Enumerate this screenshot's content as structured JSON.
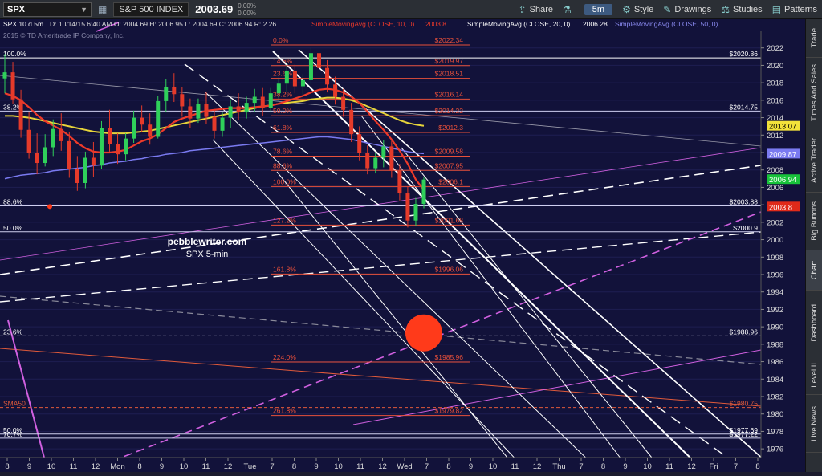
{
  "toolbar": {
    "symbol": "SPX",
    "index_name": "S&P 500 INDEX",
    "last_price": "2003.69",
    "change": "0.00%",
    "change2": "0.00%",
    "share": "Share",
    "timeframe": "5m",
    "style": "Style",
    "drawings": "Drawings",
    "studies": "Studies",
    "patterns": "Patterns"
  },
  "header": {
    "info": "SPX 10 d 5m",
    "ohlc": "D: 10/14/15 6:40 AM   O: 2004.69   H: 2006.95   L: 2004.69   C: 2006.94   R: 2.26",
    "sma10": "SimpleMovingAvg (CLOSE, 10, 0)",
    "sma10_val": "2003.8",
    "sma20": "SimpleMovingAvg (CLOSE, 20, 0)",
    "sma20_val": "2006.28",
    "sma50": "SimpleMovingAvg (CLOSE, 50, 0)",
    "copyright": "2015 © TD Ameritrade IP Company, Inc."
  },
  "watermark": {
    "line1": "pebblewriter.com",
    "line2": "SPX 5-min"
  },
  "sidebar": [
    "Trade",
    "Times And Sales",
    "Active Trader",
    "Big Buttons",
    "Chart",
    "Dashboard",
    "Level II",
    "Live News"
  ],
  "sidebar_active": "Chart",
  "colors": {
    "bg": "#12123a",
    "sma10": "#ee3a2a",
    "sma20": "#e6d43a",
    "sma50": "#7a7af0",
    "up": "#2fd05a",
    "down": "#e53a2a",
    "fib": "#e8503a",
    "channel": "#ffffff",
    "magenta": "#d060e0",
    "target": "#ff3a1a"
  },
  "chart_data": {
    "type": "candlestick",
    "y_axis": {
      "min": 1975,
      "max": 2024,
      "ticks": [
        1976,
        1978,
        1980,
        1982,
        1984,
        1986,
        1988,
        1990,
        1992,
        1994,
        1996,
        1998,
        2000,
        2002,
        2004,
        2006,
        2008,
        2010,
        2012,
        2014,
        2016,
        2018,
        2020,
        2022
      ]
    },
    "x_ticks": [
      "8",
      "9",
      "10",
      "11",
      "12",
      "Mon",
      "8",
      "9",
      "10",
      "11",
      "12",
      "Tue",
      "7",
      "8",
      "9",
      "10",
      "11",
      "12",
      "Wed",
      "7",
      "8",
      "9",
      "10",
      "11",
      "12",
      "Thu",
      "7",
      "8",
      "9",
      "10",
      "11",
      "12",
      "Fri",
      "7",
      "8"
    ],
    "price_tags": [
      {
        "label": "2013.07",
        "value": 2013.07,
        "color": "#f2e23a",
        "text": "#000"
      },
      {
        "label": "2009.87",
        "value": 2009.87,
        "color": "#7a7af0",
        "text": "#fff"
      },
      {
        "label": "2006.94",
        "value": 2006.94,
        "color": "#18c23a",
        "text": "#fff"
      },
      {
        "label": "2003.8",
        "value": 2003.8,
        "color": "#e02a1a",
        "text": "#fff"
      }
    ],
    "fib_right": [
      {
        "pct": "0.0%",
        "label": "$2022.34",
        "value": 2022.34
      },
      {
        "pct": "14.6%",
        "label": "$2019.97",
        "value": 2019.97
      },
      {
        "pct": "23.6%",
        "label": "$2018.51",
        "value": 2018.51
      },
      {
        "pct": "38.2%",
        "label": "$2016.14",
        "value": 2016.14
      },
      {
        "pct": "50.0%",
        "label": "$2014.22",
        "value": 2014.22
      },
      {
        "pct": "61.8%",
        "label": "$2012.3",
        "value": 2012.3
      },
      {
        "pct": "78.6%",
        "label": "$2009.58",
        "value": 2009.58
      },
      {
        "pct": "88.6%",
        "label": "$2007.95",
        "value": 2007.95
      },
      {
        "pct": "100.0%",
        "label": "$2006.1",
        "value": 2006.1
      },
      {
        "pct": "127.2%",
        "label": "$2001.68",
        "value": 2001.68
      },
      {
        "pct": "161.8%",
        "label": "$1996.06",
        "value": 1996.06
      },
      {
        "pct": "224.0%",
        "label": "$1985.96",
        "value": 1985.96
      },
      {
        "pct": "261.8%",
        "label": "$1979.82",
        "value": 1979.82
      }
    ],
    "fib_big": [
      {
        "pct": "100.0%",
        "label": "$2020.86",
        "value": 2020.86
      },
      {
        "pct": "38.2%",
        "label": "$2014.75",
        "value": 2014.75
      },
      {
        "pct": "88.6%",
        "label": "$2003.88",
        "value": 2003.88
      },
      {
        "pct": "50.0%",
        "label": "$2000.9",
        "value": 2000.9
      },
      {
        "pct": "23.6%",
        "label": "$1988.96",
        "value": 1988.96
      },
      {
        "pct": "SMA50",
        "label": "$1980.75",
        "value": 1980.75
      },
      {
        "pct": "50.0%",
        "label": "$1977.69",
        "value": 1977.69
      },
      {
        "pct": "70.7%",
        "label": "$1977.22",
        "value": 1977.22
      }
    ],
    "target_circle": {
      "value": 1989.3
    },
    "ohlc": [
      [
        2018.5,
        2021.3,
        2016.8,
        2019.2
      ],
      [
        2019.2,
        2020.4,
        2015.6,
        2016.1
      ],
      [
        2016.1,
        2017.2,
        2011.7,
        2012.6
      ],
      [
        2012.6,
        2014.7,
        2009.3,
        2010.0
      ],
      [
        2010.0,
        2012.2,
        2007.5,
        2008.8
      ],
      [
        2008.8,
        2012.1,
        2008.4,
        2010.6
      ],
      [
        2010.6,
        2013.8,
        2009.6,
        2012.7
      ],
      [
        2012.7,
        2014.5,
        2010.2,
        2011.3
      ],
      [
        2011.3,
        2012.4,
        2007.1,
        2008.1
      ],
      [
        2008.1,
        2009.6,
        2005.6,
        2006.5
      ],
      [
        2006.5,
        2010.1,
        2005.9,
        2009.4
      ],
      [
        2009.4,
        2011.2,
        2007.2,
        2008.5
      ],
      [
        2008.5,
        2013.6,
        2008.1,
        2012.8
      ],
      [
        2012.8,
        2014.9,
        2010.1,
        2011.0
      ],
      [
        2011.0,
        2012.2,
        2008.7,
        2009.8
      ],
      [
        2009.8,
        2012.2,
        2009.1,
        2011.6
      ],
      [
        2011.6,
        2014.8,
        2011.1,
        2014.0
      ],
      [
        2014.0,
        2015.4,
        2012.3,
        2013.2
      ],
      [
        2013.2,
        2014.5,
        2010.9,
        2011.8
      ],
      [
        2011.8,
        2016.5,
        2011.6,
        2015.9
      ],
      [
        2015.9,
        2018.4,
        2014.6,
        2017.5
      ],
      [
        2017.5,
        2019.1,
        2015.8,
        2016.7
      ],
      [
        2016.7,
        2017.5,
        2014.1,
        2015.3
      ],
      [
        2015.3,
        2016.2,
        2012.8,
        2013.9
      ],
      [
        2013.9,
        2016.2,
        2013.4,
        2015.6
      ],
      [
        2015.6,
        2017.0,
        2013.3,
        2014.1
      ],
      [
        2014.1,
        2015.0,
        2011.6,
        2012.5
      ],
      [
        2012.5,
        2014.6,
        2011.8,
        2014.0
      ],
      [
        2014.0,
        2016.1,
        2012.8,
        2015.3
      ],
      [
        2015.3,
        2016.8,
        2013.7,
        2014.6
      ],
      [
        2014.6,
        2016.4,
        2013.9,
        2015.7
      ],
      [
        2015.7,
        2017.3,
        2014.6,
        2016.4
      ],
      [
        2016.4,
        2017.4,
        2014.2,
        2015.1
      ],
      [
        2015.1,
        2017.4,
        2014.6,
        2016.8
      ],
      [
        2016.8,
        2018.6,
        2015.9,
        2017.9
      ],
      [
        2017.9,
        2020.3,
        2016.9,
        2019.4
      ],
      [
        2019.4,
        2020.1,
        2016.8,
        2017.6
      ],
      [
        2017.6,
        2019.0,
        2016.6,
        2018.3
      ],
      [
        2018.3,
        2022.0,
        2017.8,
        2021.4
      ],
      [
        2021.4,
        2022.3,
        2018.8,
        2019.7
      ],
      [
        2019.7,
        2020.6,
        2016.9,
        2017.8
      ],
      [
        2017.8,
        2018.7,
        2015.5,
        2016.4
      ],
      [
        2016.4,
        2017.3,
        2014.1,
        2014.9
      ],
      [
        2014.9,
        2015.7,
        2011.2,
        2012.1
      ],
      [
        2012.1,
        2013.0,
        2009.1,
        2010.0
      ],
      [
        2010.0,
        2010.8,
        2007.5,
        2008.2
      ],
      [
        2008.2,
        2010.0,
        2007.6,
        2009.4
      ],
      [
        2009.4,
        2011.4,
        2008.3,
        2010.7
      ],
      [
        2010.7,
        2011.5,
        2007.1,
        2007.9
      ],
      [
        2007.9,
        2008.7,
        2004.5,
        2005.3
      ],
      [
        2005.3,
        2006.1,
        2001.4,
        2002.2
      ],
      [
        2002.2,
        2004.8,
        2001.6,
        2004.1
      ],
      [
        2004.1,
        2007.2,
        2003.6,
        2006.9
      ]
    ],
    "sma10": [
      2016.8,
      2016.5,
      2016.0,
      2015.2,
      2014.3,
      2013.6,
      2013.1,
      2012.6,
      2011.9,
      2011.1,
      2010.5,
      2010.1,
      2010.0,
      2010.0,
      2010.1,
      2010.3,
      2010.8,
      2011.3,
      2011.6,
      2012.1,
      2012.8,
      2013.5,
      2013.9,
      2014.2,
      2014.5,
      2014.8,
      2014.9,
      2015.0,
      2015.1,
      2015.1,
      2015.1,
      2015.2,
      2015.3,
      2015.4,
      2015.6,
      2015.9,
      2016.2,
      2016.5,
      2016.9,
      2017.2,
      2017.3,
      2017.2,
      2016.9,
      2016.4,
      2015.7,
      2014.7,
      2013.6,
      2012.6,
      2011.5,
      2010.2,
      2008.7,
      2006.9,
      2005.7
    ],
    "sma20": [
      2014.2,
      2014.2,
      2014.1,
      2014.0,
      2013.8,
      2013.6,
      2013.4,
      2013.2,
      2013.0,
      2012.8,
      2012.6,
      2012.4,
      2012.3,
      2012.2,
      2012.2,
      2012.2,
      2012.3,
      2012.4,
      2012.5,
      2012.7,
      2012.9,
      2013.1,
      2013.3,
      2013.5,
      2013.7,
      2013.9,
      2014.1,
      2014.3,
      2014.5,
      2014.7,
      2014.9,
      2015.1,
      2015.3,
      2015.4,
      2015.6,
      2015.7,
      2015.8,
      2015.9,
      2016.1,
      2016.2,
      2016.3,
      2016.3,
      2016.2,
      2016.0,
      2015.7,
      2015.3,
      2014.9,
      2014.5,
      2014.1,
      2013.7,
      2013.4,
      2013.2,
      2013.07
    ],
    "sma50": [
      2007.0,
      2007.2,
      2007.4,
      2007.5,
      2007.6,
      2007.7,
      2007.9,
      2008.0,
      2008.1,
      2008.2,
      2008.3,
      2008.5,
      2008.6,
      2008.8,
      2008.9,
      2009.0,
      2009.2,
      2009.3,
      2009.5,
      2009.6,
      2009.8,
      2009.9,
      2010.0,
      2010.2,
      2010.3,
      2010.4,
      2010.5,
      2010.6,
      2010.7,
      2010.8,
      2010.9,
      2011.0,
      2011.1,
      2011.2,
      2011.3,
      2011.4,
      2011.5,
      2011.6,
      2011.7,
      2011.8,
      2011.8,
      2011.7,
      2011.6,
      2011.5,
      2011.3,
      2011.1,
      2010.9,
      2010.7,
      2010.5,
      2010.3,
      2010.1,
      2009.95,
      2009.87
    ]
  }
}
